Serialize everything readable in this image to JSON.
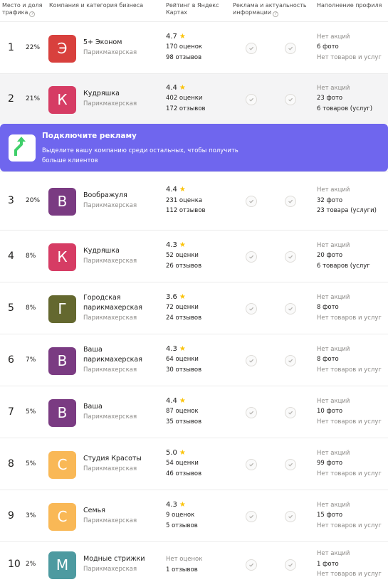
{
  "header": {
    "place_share": "Место и доля трафика",
    "company": "Компания и категория бизнеса",
    "rating": "Рейтинг в Яндекс Картах",
    "ads": "Реклама и актуальность информации",
    "profile": "Наполнение профиля"
  },
  "banner": {
    "title": "Подключите рекламу",
    "text": "Выделите вашу компанию среди остальных, чтобы получить больше клиентов"
  },
  "colors": {
    "accent_banner": "#6f66ee",
    "star": "#fbc30a"
  },
  "rows": [
    {
      "place": "1",
      "share": "22%",
      "letter": "Э",
      "name": "5+ Эконом",
      "category": "Парикмахерская",
      "rating": "4.7",
      "ratings_count": "170 оценок",
      "reviews": "98 отзывов",
      "promos": "Нет акций",
      "photos": "6 фото",
      "goods": "Нет товаров и услуг",
      "logo_color": "#d8403d"
    },
    {
      "place": "2",
      "share": "21%",
      "letter": "К",
      "name": "Кудряшка",
      "category": "Парикмахерская",
      "rating": "4.4",
      "ratings_count": "402 оценки",
      "reviews": "172 отзывов",
      "promos": "Нет акций",
      "photos": "23 фото",
      "goods": "6 товаров (услуг)",
      "logo_color": "#d63c64"
    },
    {
      "place": "3",
      "share": "20%",
      "letter": "В",
      "name": "Воображуля",
      "category": "Парикмахерская",
      "rating": "4.4",
      "ratings_count": "231 оценка",
      "reviews": "112 отзывов",
      "promos": "Нет акций",
      "photos": "32 фото",
      "goods": "23 товара (услуги)",
      "logo_color": "#7a3b82"
    },
    {
      "place": "4",
      "share": "8%",
      "letter": "К",
      "name": "Кудряшка",
      "category": "Парикмахерская",
      "rating": "4.3",
      "ratings_count": "52 оценки",
      "reviews": "26 отзывов",
      "promos": "Нет акций",
      "photos": "20 фото",
      "goods": "6 товаров (услуг",
      "logo_color": "#d63c64"
    },
    {
      "place": "5",
      "share": "8%",
      "letter": "Г",
      "name": "Городская парикмахерская",
      "category": "Парикмахерская",
      "rating": "3.6",
      "ratings_count": "72 оценки",
      "reviews": "24 отзывов",
      "promos": "Нет акций",
      "photos": "8 фото",
      "goods": "Нет товаров и услуг",
      "logo_color": "#64682f"
    },
    {
      "place": "6",
      "share": "7%",
      "letter": "В",
      "name": "Ваша парикмахерская",
      "category": "Парикмахерская",
      "rating": "4.3",
      "ratings_count": "64 оценки",
      "reviews": "30 отзывов",
      "promos": "Нет акций",
      "photos": "8 фото",
      "goods": "Нет товаров и услуг",
      "logo_color": "#7a3b82"
    },
    {
      "place": "7",
      "share": "5%",
      "letter": "В",
      "name": "Ваша",
      "category": "Парикмахерская",
      "rating": "4.4",
      "ratings_count": "87 оценок",
      "reviews": "35 отзывов",
      "promos": "Нет акций",
      "photos": "10 фото",
      "goods": "Нет товаров и услуг",
      "logo_color": "#7a3b82"
    },
    {
      "place": "8",
      "share": "5%",
      "letter": "С",
      "name": "Студия Красоты",
      "category": "Парикмахерская",
      "rating": "5.0",
      "ratings_count": "54 оценки",
      "reviews": "46 отзывов",
      "promos": "Нет акций",
      "photos": "99 фото",
      "goods": "Нет товаров и услуг",
      "logo_color": "#f9b856"
    },
    {
      "place": "9",
      "share": "3%",
      "letter": "С",
      "name": "Семья",
      "category": "Парикмахерская",
      "rating": "4.3",
      "ratings_count": "9 оценок",
      "reviews": "5 отзывов",
      "promos": "Нет акций",
      "photos": "15 фото",
      "goods": "Нет товаров и услуг",
      "logo_color": "#f9b856"
    },
    {
      "place": "10",
      "share": "2%",
      "letter": "М",
      "name": "Модные стрижки",
      "category": "Парикмахерская",
      "rating": "",
      "no_rating": "Нет оценок",
      "ratings_count": "",
      "reviews": "1 отзывов",
      "promos": "Нет акций",
      "photos": "1 фото",
      "goods": "Нет товаров и услуг",
      "logo_color": "#4d9aa0"
    }
  ]
}
